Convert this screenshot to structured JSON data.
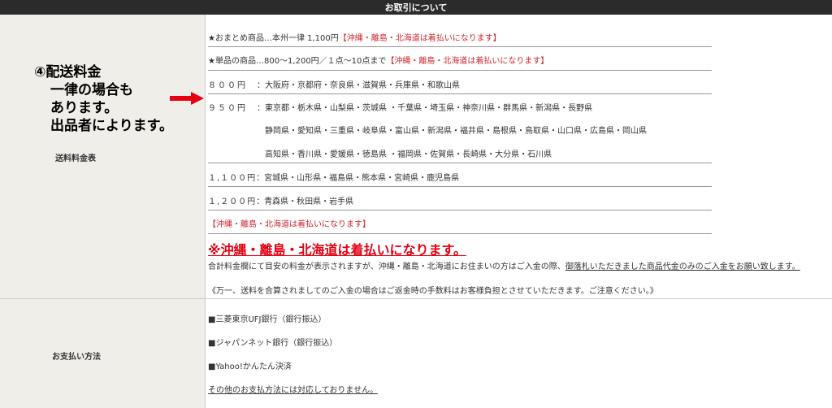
{
  "header": {
    "title": "お取引について"
  },
  "shipping": {
    "label": "送料料金表",
    "note_lines": [
      "④配送料金",
      "一律の場合も",
      "あります。",
      "出品者によります。"
    ],
    "line1_text": "★おまとめ商品…本州一律 1,100円",
    "line1_red": "【沖縄・離島・北海道は着払いになります】",
    "line2_text": "★単品の商品…800～1,200円／１点～10点まで",
    "line2_red": "【沖縄・離島・北海道は着払いになります】",
    "r800_price": "８００円",
    "r800_areas": "：大阪府・京都府・奈良県・滋賀県・兵庫県・和歌山県",
    "r950_price": "９５０円",
    "r950_areas1": "：東京都・栃木県・山梨県・茨城県 ・千葉県・埼玉県・神奈川県・群馬県・新潟県・長野県",
    "r950_areas2": "静岡県・愛知県・三重県・岐阜県・富山県・新潟県・福井県・島根県・鳥取県・山口県・広島県・岡山県",
    "r950_areas3": "高知県・香川県・愛媛県・徳島県 ・福岡県・佐賀県・長崎県・大分県・石川県",
    "r1100_price": "１,１００円",
    "r1100_areas": "：宮城県・山形県・福島県・熊本県・宮崎県・鹿児島県",
    "r1200_price": "１,２００円",
    "r1200_areas": "：青森県・秋田県・岩手県",
    "red_note": "【沖縄・離島・北海道は着払いになります】",
    "big_warning": "※沖縄・離島・北海道は着払いになります。",
    "info_text": "合計料金欄にて目安の料金が表示されますが、沖縄・離島・北海道にお住まいの方はご入金の際、",
    "info_underline": "御落札いただきました商品代金のみのご入金をお願い致します。",
    "refund_note": "《万一、送料を合算されましてのご入金の場合はご返金時の手数料はお客様負担とさせていただきます。ご注意ください。》"
  },
  "payment": {
    "label": "お支払い方法",
    "methods": [
      "■三菱東京UFJ銀行（銀行振込）",
      "■ジャパンネット銀行（銀行振込）",
      "■Yahoo!かんたん決済"
    ],
    "other": "その他のお支払方法には対応しておりません。"
  },
  "colors": {
    "accent_red": "#d0262e",
    "arrow_red": "#e60012",
    "left_bg": "#f0eee9",
    "header_bg": "#2b2b2b"
  }
}
